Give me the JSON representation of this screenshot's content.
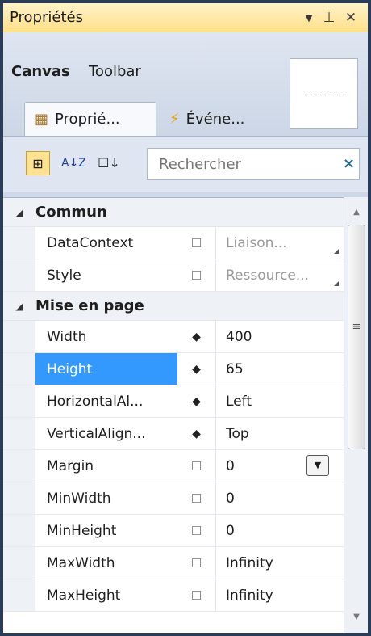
{
  "window": {
    "title": "Propriétés",
    "buttons": {
      "dropdown": "▼",
      "pin": "⊥",
      "close": "✕"
    }
  },
  "header": {
    "object_type": "Canvas",
    "object_name": "Toolbar",
    "tabs": [
      {
        "label": "Proprié...",
        "icon": "properties-icon",
        "active": true
      },
      {
        "label": "Événe...",
        "icon": "lightning-icon",
        "active": false
      }
    ]
  },
  "toolbar": {
    "categorize_icon": "⊞",
    "sort_icon": "A↓Z",
    "filter_icon": "☐↓",
    "search_placeholder": "Rechercher",
    "search_clear": "×"
  },
  "grid": {
    "categories": [
      {
        "name": "Commun",
        "rows": [
          {
            "name": "DataContext",
            "marker": "☐",
            "value": "Liaison...",
            "muted": true
          },
          {
            "name": "Style",
            "marker": "☐",
            "value": "Ressource...",
            "muted": true
          }
        ]
      },
      {
        "name": "Mise en page",
        "rows": [
          {
            "name": "Width",
            "marker": "◆",
            "value": "400"
          },
          {
            "name": "Height",
            "marker": "◆",
            "value": "65",
            "selected": true
          },
          {
            "name": "HorizontalAl...",
            "marker": "◆",
            "value": "Left"
          },
          {
            "name": "VerticalAlign...",
            "marker": "◆",
            "value": "Top"
          },
          {
            "name": "Margin",
            "marker": "☐",
            "value": "0",
            "dropdown": true
          },
          {
            "name": "MinWidth",
            "marker": "☐",
            "value": "0"
          },
          {
            "name": "MinHeight",
            "marker": "☐",
            "value": "0"
          },
          {
            "name": "MaxWidth",
            "marker": "☐",
            "value": "Infinity"
          },
          {
            "name": "MaxHeight",
            "marker": "☐",
            "value": "Infinity"
          }
        ]
      }
    ]
  },
  "colors": {
    "selection": "#3399ff",
    "title_bar": "#ffe08a",
    "frame": "#2b3c59"
  }
}
